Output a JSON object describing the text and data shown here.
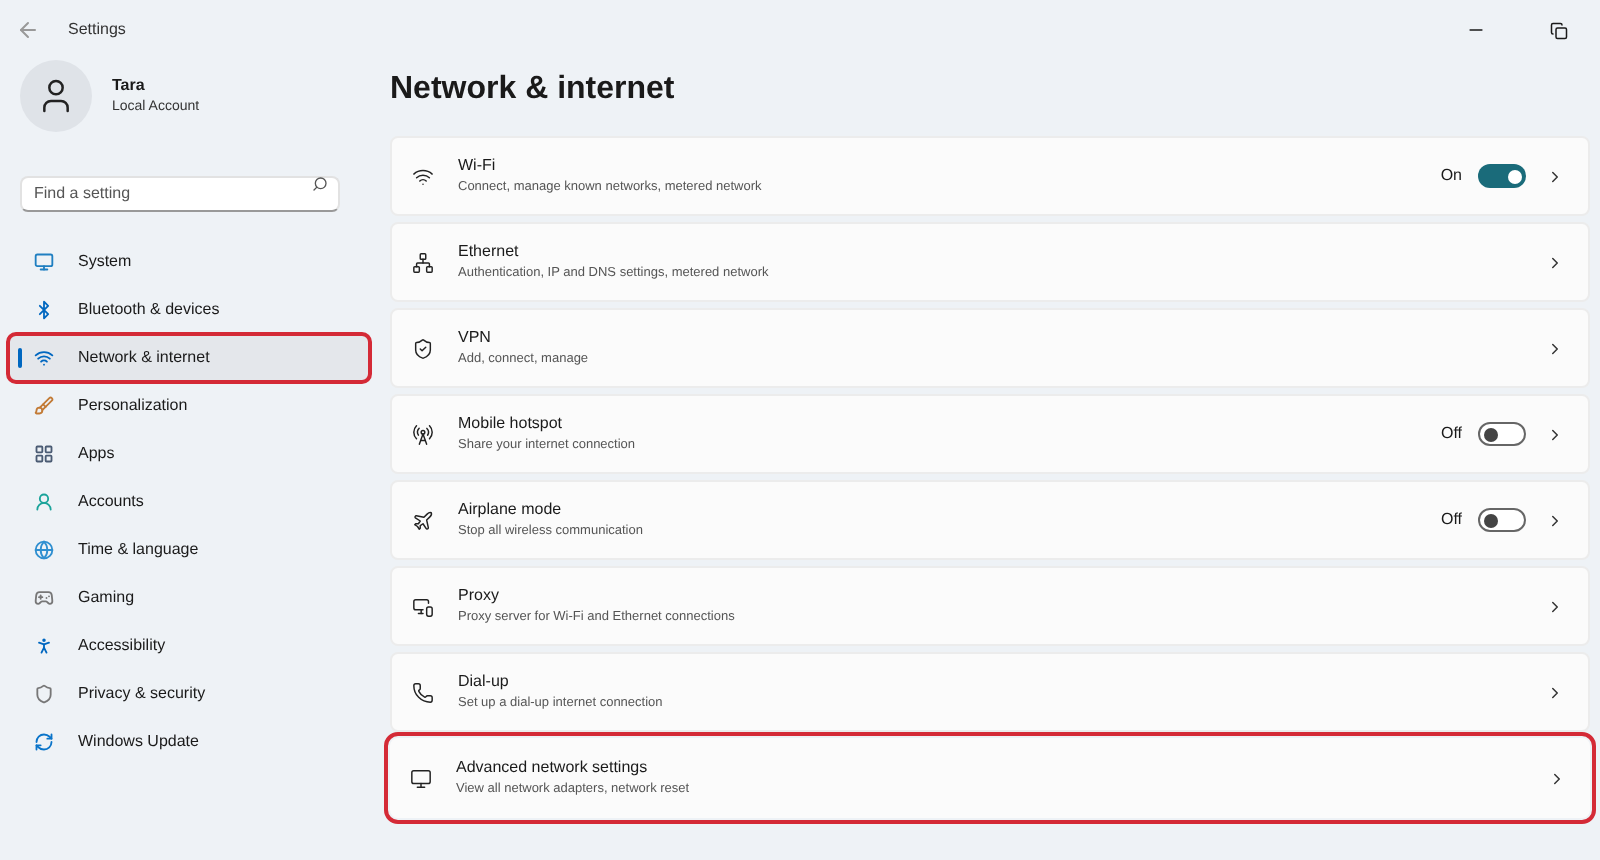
{
  "window": {
    "title": "Settings"
  },
  "account": {
    "name": "Tara",
    "type": "Local Account"
  },
  "search": {
    "placeholder": "Find a setting"
  },
  "sidebar": {
    "items": [
      {
        "label": "System",
        "selected": false,
        "highlighted": false
      },
      {
        "label": "Bluetooth & devices",
        "selected": false,
        "highlighted": false
      },
      {
        "label": "Network & internet",
        "selected": true,
        "highlighted": true
      },
      {
        "label": "Personalization",
        "selected": false,
        "highlighted": false
      },
      {
        "label": "Apps",
        "selected": false,
        "highlighted": false
      },
      {
        "label": "Accounts",
        "selected": false,
        "highlighted": false
      },
      {
        "label": "Time & language",
        "selected": false,
        "highlighted": false
      },
      {
        "label": "Gaming",
        "selected": false,
        "highlighted": false
      },
      {
        "label": "Accessibility",
        "selected": false,
        "highlighted": false
      },
      {
        "label": "Privacy & security",
        "selected": false,
        "highlighted": false
      },
      {
        "label": "Windows Update",
        "selected": false,
        "highlighted": false
      }
    ]
  },
  "page": {
    "title": "Network & internet"
  },
  "cards": [
    {
      "kind": "toggle",
      "title": "Wi-Fi",
      "description": "Connect, manage known networks, metered network",
      "state": "On",
      "on": true,
      "highlighted": false
    },
    {
      "kind": "link",
      "title": "Ethernet",
      "description": "Authentication, IP and DNS settings, metered network",
      "highlighted": false
    },
    {
      "kind": "link",
      "title": "VPN",
      "description": "Add, connect, manage",
      "highlighted": false
    },
    {
      "kind": "toggle",
      "title": "Mobile hotspot",
      "description": "Share your internet connection",
      "state": "Off",
      "on": false,
      "highlighted": false
    },
    {
      "kind": "toggle",
      "title": "Airplane mode",
      "description": "Stop all wireless communication",
      "state": "Off",
      "on": false,
      "highlighted": false
    },
    {
      "kind": "link",
      "title": "Proxy",
      "description": "Proxy server for Wi-Fi and Ethernet connections",
      "highlighted": false
    },
    {
      "kind": "link",
      "title": "Dial-up",
      "description": "Set up a dial-up internet connection",
      "highlighted": false
    },
    {
      "kind": "link",
      "title": "Advanced network settings",
      "description": "View all network adapters, network reset",
      "highlighted": true
    }
  ]
}
